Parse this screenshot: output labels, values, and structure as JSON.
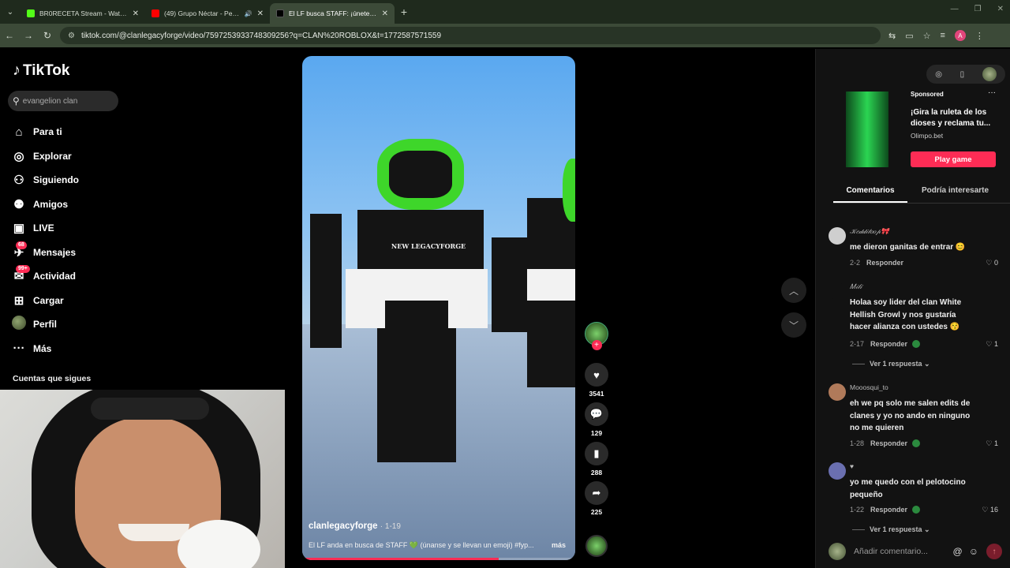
{
  "browser": {
    "tabs": [
      {
        "title": "BR0RECETA Stream - Watch Liv",
        "favicon_color": "#53fc18",
        "active": false
      },
      {
        "title": "(49) Grupo Néctar - Pecado",
        "favicon_color": "#ff0000",
        "active": false
      },
      {
        "title": "El LF busca STAFF: ¡únete y llev",
        "favicon_color": "#000000",
        "active": true
      }
    ],
    "url": "tiktok.com/@clanlegacyforge/video/7597253933748309256?q=CLAN%20ROBLOX&t=1772587571559",
    "profile_initial": "A"
  },
  "tiktok": {
    "logo_text": "TikTok",
    "search_placeholder": "evangelion clan",
    "nav": [
      {
        "label": "Para ti",
        "icon": "home-icon",
        "glyph": "⌂"
      },
      {
        "label": "Explorar",
        "icon": "compass-icon",
        "glyph": "◎"
      },
      {
        "label": "Siguiendo",
        "icon": "following-icon",
        "glyph": "⚇"
      },
      {
        "label": "Amigos",
        "icon": "friends-icon",
        "glyph": "⚉"
      },
      {
        "label": "LIVE",
        "icon": "live-icon",
        "glyph": "▣"
      },
      {
        "label": "Mensajes",
        "icon": "messages-icon",
        "glyph": "✈",
        "badge": "68"
      },
      {
        "label": "Actividad",
        "icon": "activity-icon",
        "glyph": "✉",
        "badge": "99+"
      },
      {
        "label": "Cargar",
        "icon": "upload-icon",
        "glyph": "⊞"
      },
      {
        "label": "Perfil",
        "icon": "profile-avatar",
        "glyph": ""
      },
      {
        "label": "Más",
        "icon": "more-icon",
        "glyph": "···"
      }
    ],
    "following_header": "Cuentas que sigues"
  },
  "video": {
    "username": "clanlegacyforge",
    "date": "· 1-19",
    "description": "El LF anda en busca de STAFF 💚 (únanse y se llevan un emoji) #fyp...",
    "more_label": "más",
    "shirt_text": "NEW LEGACYFORGE",
    "progress": 0.72
  },
  "actions": {
    "likes": "3541",
    "comments": "129",
    "saves": "288",
    "shares": "225"
  },
  "ad": {
    "sponsored": "Sponsored",
    "title": "¡Gira la ruleta de los dioses y reclama tu...",
    "site": "Olimpo.bet",
    "cta": "Play game"
  },
  "panel_tabs": {
    "comments": "Comentarios",
    "related": "Podría interesarte"
  },
  "comments": [
    {
      "user": "𝒦𝑒𝒹𝒹𝒾𝓉𝑜𝑜𝓅🎀",
      "text": "me dieron ganitas de entrar 😊",
      "date": "2-2",
      "reply": "Responder",
      "likes": "0",
      "replies": "",
      "avatar_color": "#cfcfcf"
    },
    {
      "user": "𝑀𝒾𝓁𝒾",
      "text": "Holaa soy lider del clan White Hellish Growl y nos gustaría hacer alianza con ustedes 😚",
      "date": "2-17",
      "reply": "Responder",
      "likes": "1",
      "replies": "Ver 1 respuesta",
      "avatar_color": "#121212"
    },
    {
      "user": "Mooosqui_to",
      "text": "eh we pq solo me salen edits de clanes y yo no ando en ninguno no me quieren",
      "date": "1-28",
      "reply": "Responder",
      "likes": "1",
      "replies": "",
      "avatar_color": "#b07a5a"
    },
    {
      "user": "♥",
      "text": "yo me quedo con el pelotocino pequeño",
      "date": "1-22",
      "reply": "Responder",
      "likes": "16",
      "replies": "Ver 1 respuesta",
      "avatar_color": "#6a6fb0"
    }
  ],
  "compose": {
    "placeholder": "Añadir comentario..."
  }
}
